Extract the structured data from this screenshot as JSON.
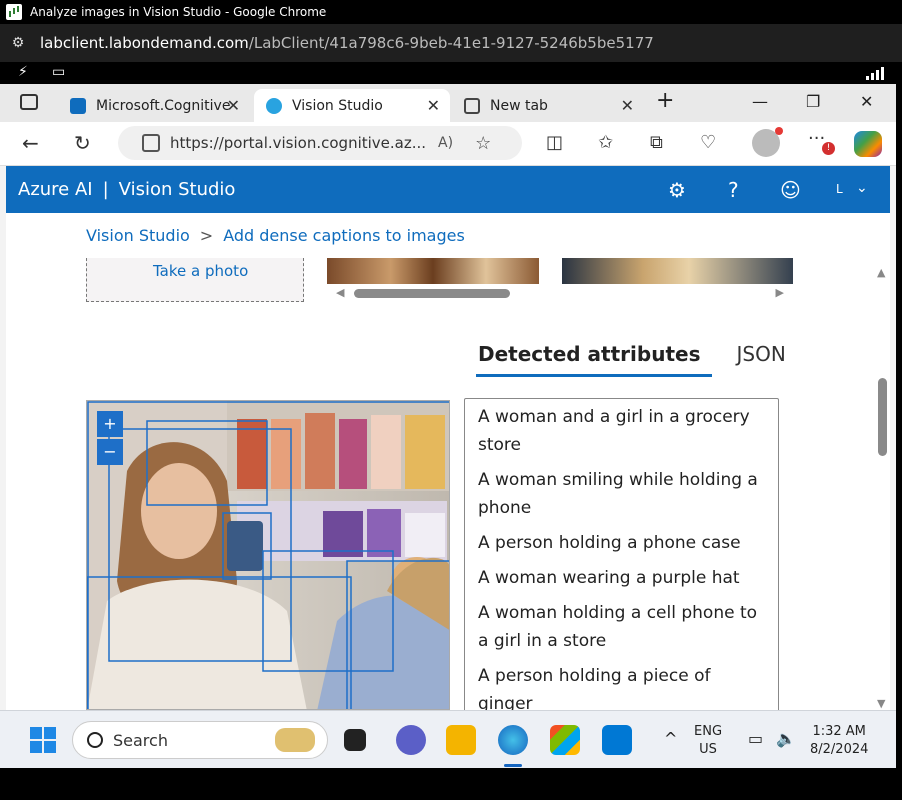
{
  "window": {
    "title": "Analyze images in Vision Studio - Google Chrome",
    "url_domain": "labclient.labondemand.com",
    "url_path": "/LabClient/41a798c6-9beb-41e1-9127-5246b5be5177"
  },
  "edge": {
    "tabs": [
      {
        "label": "Microsoft.Cognitive",
        "active": false
      },
      {
        "label": "Vision Studio",
        "active": true
      },
      {
        "label": "New tab",
        "active": false
      }
    ],
    "address": "https://portal.vision.cognitive.az..."
  },
  "studio": {
    "brand": "Azure AI",
    "product": "Vision Studio",
    "user_initial": "L"
  },
  "breadcrumb": {
    "root": "Vision Studio",
    "sep": ">",
    "current": "Add dense captions to images"
  },
  "samples": {
    "take_photo": "Take a photo"
  },
  "result_tabs": {
    "attributes": "Detected attributes",
    "json": "JSON"
  },
  "zoom": {
    "in": "+",
    "out": "−"
  },
  "captions": [
    "A woman and a girl in a grocery store",
    "A woman smiling while holding a phone",
    "A person holding a phone case",
    "A woman wearing a purple hat",
    "A woman holding a cell phone to a girl in a store",
    "A person holding a piece of ginger"
  ],
  "taskbar": {
    "search": "Search",
    "lang_top": "ENG",
    "lang_bottom": "US",
    "time": "1:32 AM",
    "date": "8/2/2024"
  },
  "colors": {
    "azure_header": "#0f6cbd",
    "link": "#0f6cbd",
    "box_outline": "#1e6fc8"
  }
}
